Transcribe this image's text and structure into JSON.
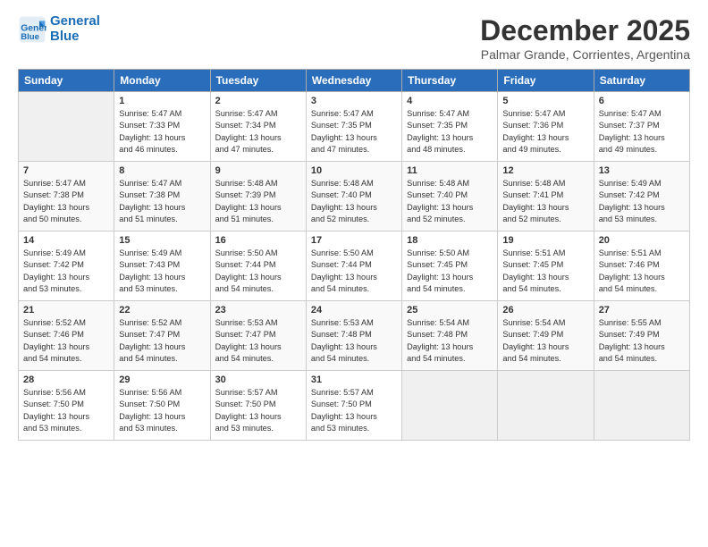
{
  "header": {
    "logo_line1": "General",
    "logo_line2": "Blue",
    "month": "December 2025",
    "location": "Palmar Grande, Corrientes, Argentina"
  },
  "weekdays": [
    "Sunday",
    "Monday",
    "Tuesday",
    "Wednesday",
    "Thursday",
    "Friday",
    "Saturday"
  ],
  "weeks": [
    [
      {
        "day": "",
        "content": ""
      },
      {
        "day": "1",
        "content": "Sunrise: 5:47 AM\nSunset: 7:33 PM\nDaylight: 13 hours\nand 46 minutes."
      },
      {
        "day": "2",
        "content": "Sunrise: 5:47 AM\nSunset: 7:34 PM\nDaylight: 13 hours\nand 47 minutes."
      },
      {
        "day": "3",
        "content": "Sunrise: 5:47 AM\nSunset: 7:35 PM\nDaylight: 13 hours\nand 47 minutes."
      },
      {
        "day": "4",
        "content": "Sunrise: 5:47 AM\nSunset: 7:35 PM\nDaylight: 13 hours\nand 48 minutes."
      },
      {
        "day": "5",
        "content": "Sunrise: 5:47 AM\nSunset: 7:36 PM\nDaylight: 13 hours\nand 49 minutes."
      },
      {
        "day": "6",
        "content": "Sunrise: 5:47 AM\nSunset: 7:37 PM\nDaylight: 13 hours\nand 49 minutes."
      }
    ],
    [
      {
        "day": "7",
        "content": "Sunrise: 5:47 AM\nSunset: 7:38 PM\nDaylight: 13 hours\nand 50 minutes."
      },
      {
        "day": "8",
        "content": "Sunrise: 5:47 AM\nSunset: 7:38 PM\nDaylight: 13 hours\nand 51 minutes."
      },
      {
        "day": "9",
        "content": "Sunrise: 5:48 AM\nSunset: 7:39 PM\nDaylight: 13 hours\nand 51 minutes."
      },
      {
        "day": "10",
        "content": "Sunrise: 5:48 AM\nSunset: 7:40 PM\nDaylight: 13 hours\nand 52 minutes."
      },
      {
        "day": "11",
        "content": "Sunrise: 5:48 AM\nSunset: 7:40 PM\nDaylight: 13 hours\nand 52 minutes."
      },
      {
        "day": "12",
        "content": "Sunrise: 5:48 AM\nSunset: 7:41 PM\nDaylight: 13 hours\nand 52 minutes."
      },
      {
        "day": "13",
        "content": "Sunrise: 5:49 AM\nSunset: 7:42 PM\nDaylight: 13 hours\nand 53 minutes."
      }
    ],
    [
      {
        "day": "14",
        "content": "Sunrise: 5:49 AM\nSunset: 7:42 PM\nDaylight: 13 hours\nand 53 minutes."
      },
      {
        "day": "15",
        "content": "Sunrise: 5:49 AM\nSunset: 7:43 PM\nDaylight: 13 hours\nand 53 minutes."
      },
      {
        "day": "16",
        "content": "Sunrise: 5:50 AM\nSunset: 7:44 PM\nDaylight: 13 hours\nand 54 minutes."
      },
      {
        "day": "17",
        "content": "Sunrise: 5:50 AM\nSunset: 7:44 PM\nDaylight: 13 hours\nand 54 minutes."
      },
      {
        "day": "18",
        "content": "Sunrise: 5:50 AM\nSunset: 7:45 PM\nDaylight: 13 hours\nand 54 minutes."
      },
      {
        "day": "19",
        "content": "Sunrise: 5:51 AM\nSunset: 7:45 PM\nDaylight: 13 hours\nand 54 minutes."
      },
      {
        "day": "20",
        "content": "Sunrise: 5:51 AM\nSunset: 7:46 PM\nDaylight: 13 hours\nand 54 minutes."
      }
    ],
    [
      {
        "day": "21",
        "content": "Sunrise: 5:52 AM\nSunset: 7:46 PM\nDaylight: 13 hours\nand 54 minutes."
      },
      {
        "day": "22",
        "content": "Sunrise: 5:52 AM\nSunset: 7:47 PM\nDaylight: 13 hours\nand 54 minutes."
      },
      {
        "day": "23",
        "content": "Sunrise: 5:53 AM\nSunset: 7:47 PM\nDaylight: 13 hours\nand 54 minutes."
      },
      {
        "day": "24",
        "content": "Sunrise: 5:53 AM\nSunset: 7:48 PM\nDaylight: 13 hours\nand 54 minutes."
      },
      {
        "day": "25",
        "content": "Sunrise: 5:54 AM\nSunset: 7:48 PM\nDaylight: 13 hours\nand 54 minutes."
      },
      {
        "day": "26",
        "content": "Sunrise: 5:54 AM\nSunset: 7:49 PM\nDaylight: 13 hours\nand 54 minutes."
      },
      {
        "day": "27",
        "content": "Sunrise: 5:55 AM\nSunset: 7:49 PM\nDaylight: 13 hours\nand 54 minutes."
      }
    ],
    [
      {
        "day": "28",
        "content": "Sunrise: 5:56 AM\nSunset: 7:50 PM\nDaylight: 13 hours\nand 53 minutes."
      },
      {
        "day": "29",
        "content": "Sunrise: 5:56 AM\nSunset: 7:50 PM\nDaylight: 13 hours\nand 53 minutes."
      },
      {
        "day": "30",
        "content": "Sunrise: 5:57 AM\nSunset: 7:50 PM\nDaylight: 13 hours\nand 53 minutes."
      },
      {
        "day": "31",
        "content": "Sunrise: 5:57 AM\nSunset: 7:50 PM\nDaylight: 13 hours\nand 53 minutes."
      },
      {
        "day": "",
        "content": ""
      },
      {
        "day": "",
        "content": ""
      },
      {
        "day": "",
        "content": ""
      }
    ]
  ]
}
